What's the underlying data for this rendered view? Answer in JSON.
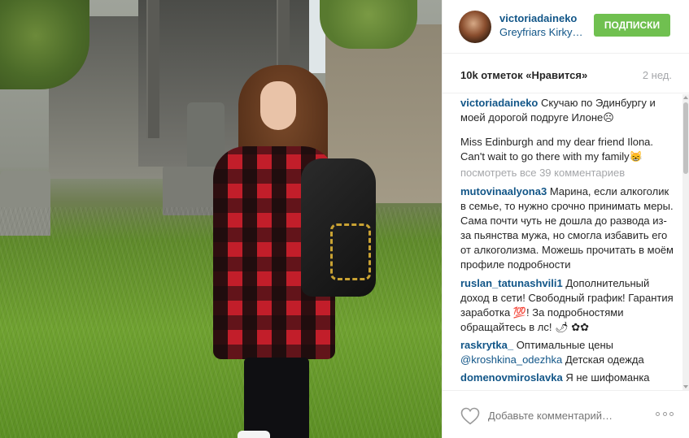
{
  "photo": {
    "alt_icon": "photo"
  },
  "header": {
    "username": "victoriadaineko",
    "location": "Greyfriars Kirky…",
    "follow_label": "ПОДПИСКИ",
    "follow_color": "#70c050",
    "avatar_icon": "avatar"
  },
  "stats": {
    "likes": "10k отметок «Нравится»",
    "time": "2 нед."
  },
  "caption": {
    "author": "victoriadaineko",
    "text_ru": "Скучаю по Эдинбургу и моей дорогой подруге Илоне☹",
    "text_en": "Miss Edinburgh and my dear friend Ilona. Can't wait to go there with my family😸"
  },
  "view_all": "посмотреть все 39 комментариев",
  "comments": [
    {
      "author": "mutovinaalyona3",
      "text": "Марина, если алкоголик в семье, то нужно срочно принимать меры. Сама почти чуть не дошла до развода из-за пьянства мужа, но смогла избавить его от алкоголизма. Можешь прочитать в моём профиле подробности"
    },
    {
      "author": "ruslan_tatunashvili1",
      "text": "Дополнительный доход в сети! Свободный график! Гарантия заработка 💯! За подробностями обращайтесь в лс! 🌶 ✿✿"
    },
    {
      "author": "raskrytka_",
      "text": "Оптимальные цены",
      "mention": "@kroshkina_odezhka",
      "text2": "Детская одежда"
    },
    {
      "author": "domenovmiroslavka",
      "text": "Я не шифоманка"
    }
  ],
  "footer": {
    "add_comment_placeholder": "Добавьте комментарий…",
    "heart_icon": "heart-outline",
    "more_icon": "ellipsis"
  }
}
